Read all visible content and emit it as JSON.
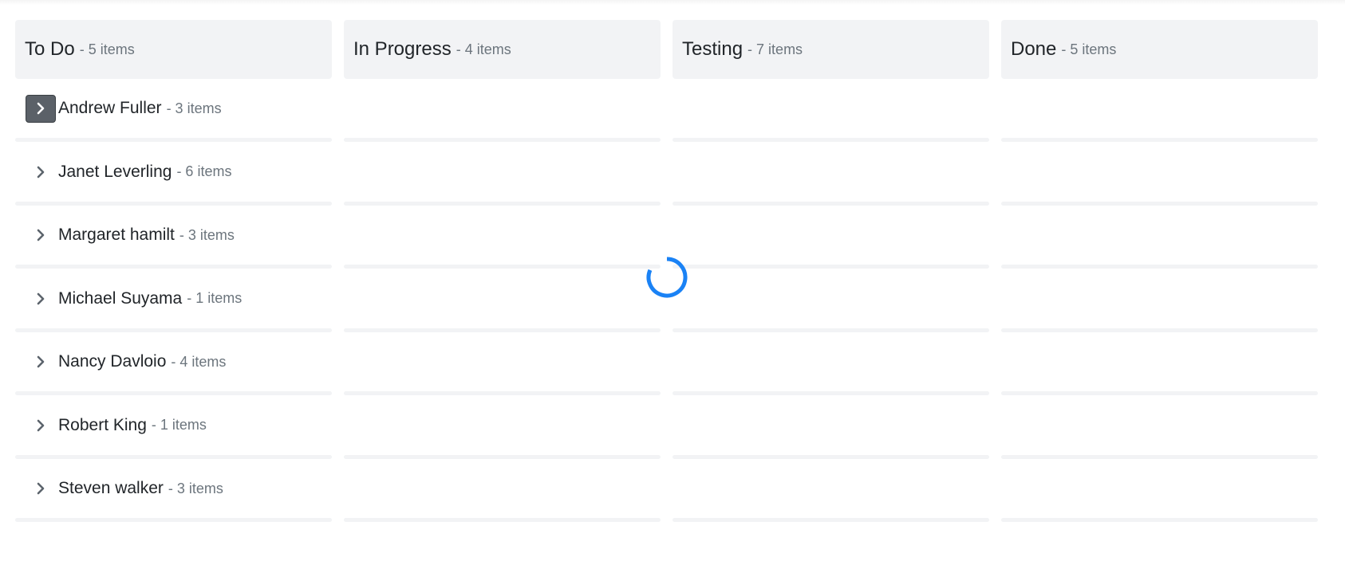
{
  "columns": [
    {
      "title": "To Do",
      "count": "- 5 items"
    },
    {
      "title": "In Progress",
      "count": "- 4 items"
    },
    {
      "title": "Testing",
      "count": "- 7 items"
    },
    {
      "title": "Done",
      "count": "- 5 items"
    }
  ],
  "swimlanes": [
    {
      "name": "Andrew Fuller",
      "count": "- 3 items",
      "focused": true
    },
    {
      "name": "Janet Leverling",
      "count": "- 6 items"
    },
    {
      "name": "Margaret hamilt",
      "count": "- 3 items"
    },
    {
      "name": "Michael Suyama",
      "count": "- 1 items"
    },
    {
      "name": "Nancy Davloio",
      "count": "- 4 items"
    },
    {
      "name": "Robert King",
      "count": "- 1 items"
    },
    {
      "name": "Steven walker",
      "count": "- 3 items"
    }
  ],
  "icons": {
    "toggle": "chevron-right-icon",
    "loading": "spinner-icon"
  },
  "colors": {
    "spinner": "#1a82f5",
    "header_bg": "#f2f3f5",
    "toggle_active_bg": "#5b6168"
  }
}
